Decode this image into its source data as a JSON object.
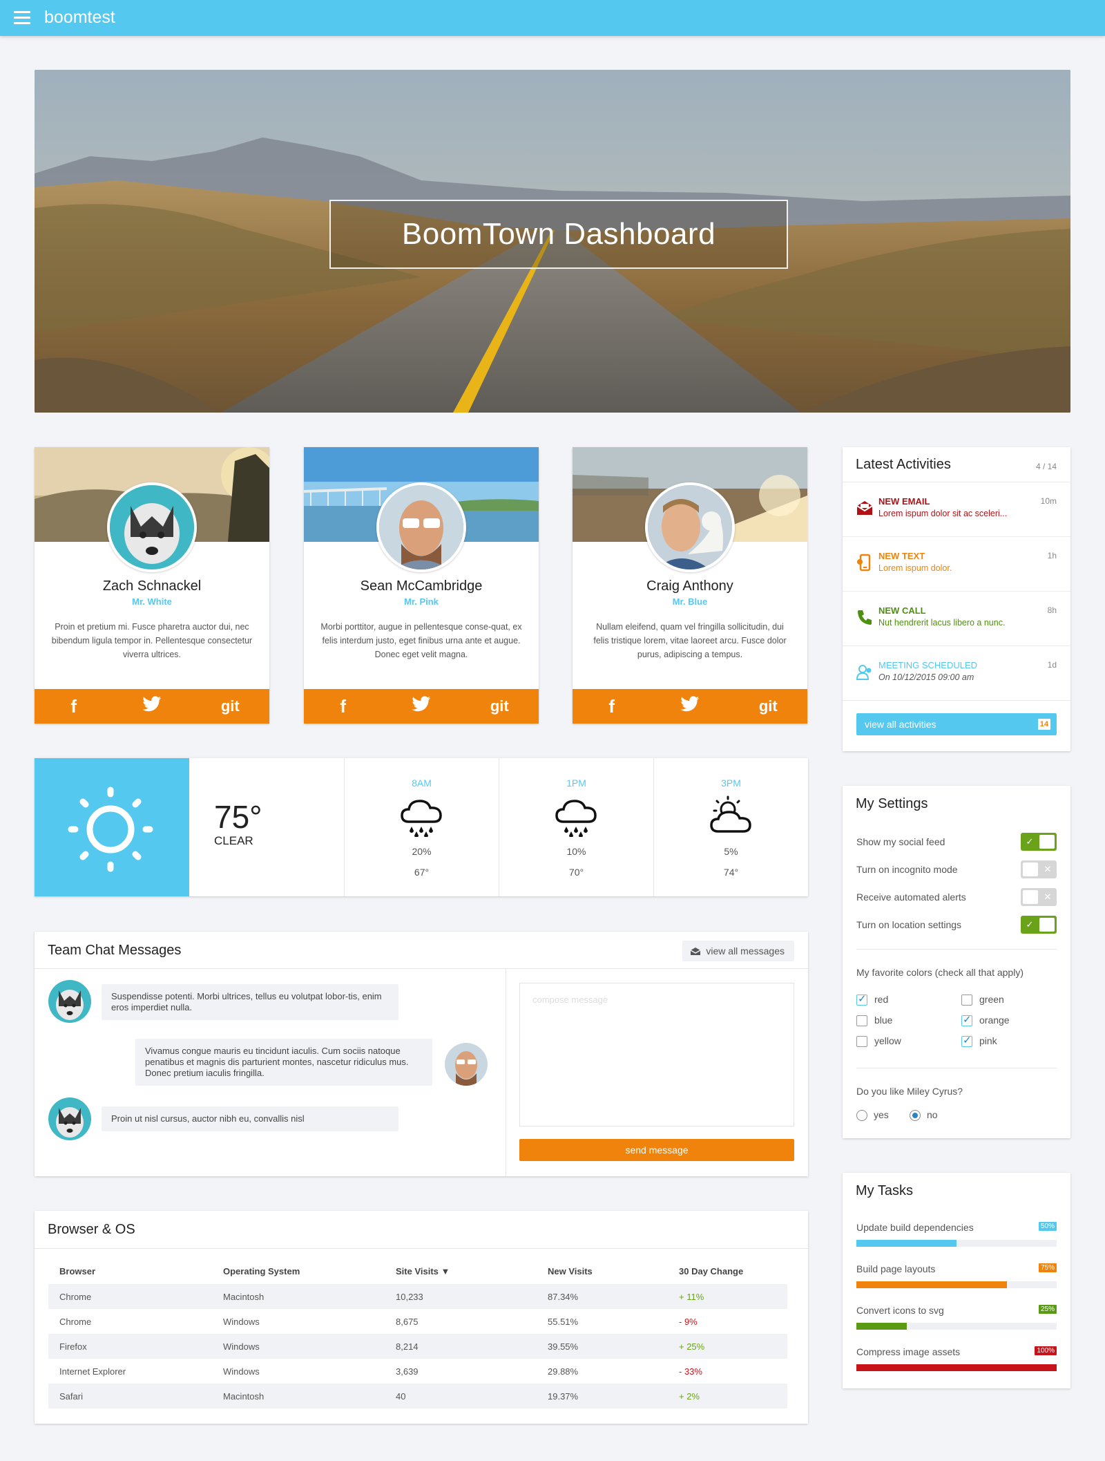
{
  "app": {
    "title": "boomtest"
  },
  "hero": {
    "title": "BoomTown Dashboard"
  },
  "profiles": [
    {
      "name": "Zach Schnackel",
      "nick": "Mr. White",
      "bio": "Proin et pretium mi. Fusce pharetra auctor dui, nec bibendum ligula tempor in. Pellentesque consectetur viverra ultrices."
    },
    {
      "name": "Sean McCambridge",
      "nick": "Mr. Pink",
      "bio": "Morbi porttitor, augue in pellentesque conse-quat, ex felis interdum justo, eget finibus urna ante et augue. Donec eget velit magna."
    },
    {
      "name": "Craig Anthony",
      "nick": "Mr. Blue",
      "bio": "Nullam eleifend, quam vel fringilla sollicitudin, dui felis tristique lorem, vitae laoreet arcu. Fusce dolor purus, adipiscing a tempus."
    }
  ],
  "social": {
    "facebook": "f",
    "twitter": "twitter-icon",
    "git": "git"
  },
  "weather": {
    "current": {
      "temp": "75°",
      "condition": "CLEAR",
      "icon": "sun-icon"
    },
    "forecast": [
      {
        "time": "8AM",
        "icon": "rain-cloud-icon",
        "precip": "20%",
        "temp": "67°"
      },
      {
        "time": "1PM",
        "icon": "rain-cloud-icon",
        "precip": "10%",
        "temp": "70°"
      },
      {
        "time": "3PM",
        "icon": "partly-cloudy-icon",
        "precip": "5%",
        "temp": "74°"
      }
    ]
  },
  "chat": {
    "title": "Team Chat Messages",
    "view_all": "view all messages",
    "messages": [
      {
        "text": "Suspendisse potenti. Morbi ultrices, tellus eu volutpat lobor-tis, enim eros imperdiet nulla."
      },
      {
        "text": "Vivamus congue mauris eu tincidunt iaculis. Cum sociis natoque penatibus et magnis dis parturient montes, nascetur ridiculus mus. Donec pretium iaculis fringilla."
      },
      {
        "text": "Proin ut nisl cursus, auctor nibh eu, convallis nisl"
      }
    ],
    "compose_placeholder": "compose message",
    "send_label": "send message"
  },
  "browser": {
    "title": "Browser & OS",
    "columns": [
      "Browser",
      "Operating System",
      "Site Visits ▼",
      "New Visits",
      "30 Day Change"
    ],
    "rows": [
      [
        "Chrome",
        "Macintosh",
        "10,233",
        "87.34%",
        "+ 11%"
      ],
      [
        "Chrome",
        "Windows",
        "8,675",
        "55.51%",
        "- 9%"
      ],
      [
        "Firefox",
        "Windows",
        "8,214",
        "39.55%",
        "+ 25%"
      ],
      [
        "Internet Explorer",
        "Windows",
        "3,639",
        "29.88%",
        "- 33%"
      ],
      [
        "Safari",
        "Macintosh",
        "40",
        "19.37%",
        "+ 2%"
      ]
    ]
  },
  "activities": {
    "title": "Latest Activities",
    "count": "4 / 14",
    "items": [
      {
        "type": "NEW EMAIL",
        "text": "Lorem ispum dolor sit ac sceleri...",
        "ago": "10m",
        "color": "#b01117",
        "icon": "envelope-icon"
      },
      {
        "type": "NEW TEXT",
        "text": "Lorem ispum dolor.",
        "ago": "1h",
        "color": "#f0830b",
        "icon": "phone-text-icon"
      },
      {
        "type": "NEW CALL",
        "text": "Nut hendrerit lacus libero a nunc.",
        "ago": "8h",
        "color": "#4d8f0e",
        "icon": "phone-icon"
      },
      {
        "type": "MEETING SCHEDULED",
        "text": "On 10/12/2015 09:00 am",
        "ago": "1d",
        "color": "#54c8ef",
        "icon": "meeting-icon"
      }
    ],
    "view_all": "view all activities",
    "badge": "14"
  },
  "settings": {
    "title": "My Settings",
    "toggles": [
      {
        "label": "Show my social feed",
        "on": true
      },
      {
        "label": "Turn on incognito mode",
        "on": false
      },
      {
        "label": "Receive automated alerts",
        "on": false
      },
      {
        "label": "Turn on location settings",
        "on": true
      }
    ],
    "colors_label": "My favorite colors (check all that apply)",
    "colors": [
      {
        "label": "red",
        "checked": true
      },
      {
        "label": "green",
        "checked": false
      },
      {
        "label": "blue",
        "checked": false
      },
      {
        "label": "orange",
        "checked": true
      },
      {
        "label": "yellow",
        "checked": false
      },
      {
        "label": "pink",
        "checked": true
      }
    ],
    "question": "Do you like Miley Cyrus?",
    "answers": [
      {
        "label": "yes",
        "selected": false
      },
      {
        "label": "no",
        "selected": true
      }
    ]
  },
  "tasks": {
    "title": "My Tasks",
    "items": [
      {
        "label": "Update build dependencies",
        "percent": "50%",
        "progress": 0.5,
        "color": "#54c8ef"
      },
      {
        "label": "Build page layouts",
        "percent": "75%",
        "progress": 0.75,
        "color": "#f0830b"
      },
      {
        "label": "Convert icons to svg",
        "percent": "25%",
        "progress": 0.25,
        "color": "#5a9a14"
      },
      {
        "label": "Compress image assets",
        "percent": "100%",
        "progress": 1.0,
        "color": "#c7131a"
      }
    ]
  },
  "colors": {
    "accent": "#54c8ef",
    "orange": "#f0830b",
    "green": "#6aa31a",
    "red": "#c7131a"
  }
}
